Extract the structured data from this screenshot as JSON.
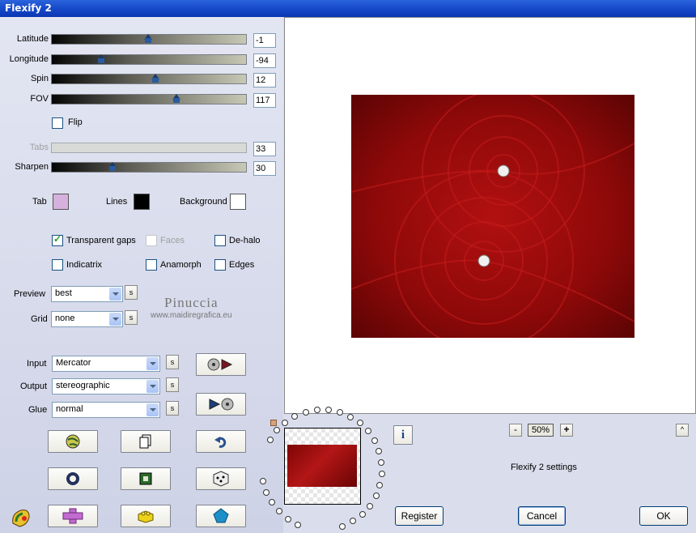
{
  "window": {
    "title": "Flexify 2"
  },
  "sliders": [
    {
      "label": "Latitude",
      "value": "-1",
      "level": 0.5
    },
    {
      "label": "Longitude",
      "value": "-94",
      "level": 0.25
    },
    {
      "label": "Spin",
      "value": "12",
      "level": 0.53
    },
    {
      "label": "FOV",
      "value": "117",
      "level": 0.64
    }
  ],
  "flip": {
    "label": "Flip",
    "checked": false
  },
  "tabs": {
    "label": "Tabs",
    "value": "33",
    "disabled": true
  },
  "sharpen": {
    "label": "Sharpen",
    "value": "30",
    "level": 0.31
  },
  "colors": {
    "tab": {
      "label": "Tab",
      "color": "#d7b1dd"
    },
    "lines": {
      "label": "Lines",
      "color": "#000000"
    },
    "background": {
      "label": "Background",
      "color": "#ffffff"
    }
  },
  "checkboxes": {
    "transparent_gaps": {
      "label": "Transparent gaps",
      "checked": true
    },
    "faces": {
      "label": "Faces",
      "checked": false,
      "disabled": true
    },
    "dehalo": {
      "label": "De-halo",
      "checked": false
    },
    "indicatrix": {
      "label": "Indicatrix",
      "checked": false
    },
    "anamorph": {
      "label": "Anamorph",
      "checked": false
    },
    "edges": {
      "label": "Edges",
      "checked": false
    }
  },
  "preview_select": {
    "label": "Preview",
    "value": "best"
  },
  "grid_select": {
    "label": "Grid",
    "value": "none"
  },
  "watermark": {
    "name": "Pinuccia",
    "site": "www.maidiregrafica.eu"
  },
  "input_select": {
    "label": "Input",
    "value": "Mercator"
  },
  "output_select": {
    "label": "Output",
    "value": "stereographic"
  },
  "glue_select": {
    "label": "Glue",
    "value": "normal"
  },
  "s_button": "s",
  "zoom": {
    "value": "50%",
    "minus": "-",
    "plus": "+"
  },
  "settings_text": "Flexify 2 settings",
  "info_label": "i",
  "buttons": {
    "register": "Register",
    "cancel": "Cancel",
    "ok": "OK"
  },
  "colors_ui": {
    "accent": "#1547c7",
    "image_red": "#9e0a0a"
  }
}
